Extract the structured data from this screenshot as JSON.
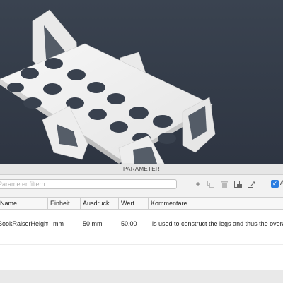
{
  "dialog": {
    "title": "PARAMETER",
    "filter_placeholder": "Parameter filtern",
    "all_label": "A",
    "toolbar_icons": [
      "add-icon",
      "copy-icon",
      "delete-icon",
      "import-icon",
      "export-icon"
    ]
  },
  "table": {
    "headers": [
      "Name",
      "Einheit",
      "Ausdruck",
      "Wert",
      "Kommentare"
    ],
    "rows": [
      {
        "name": "BookRaiserHeight",
        "unit": "mm",
        "expression": "50 mm",
        "value": "50.00",
        "comment": "is used to construct the legs and thus the overall height"
      }
    ]
  },
  "colors": {
    "viewport_bg": "#333a46",
    "model": "#f4f4f4",
    "checkbox_accent": "#2a7de1"
  }
}
